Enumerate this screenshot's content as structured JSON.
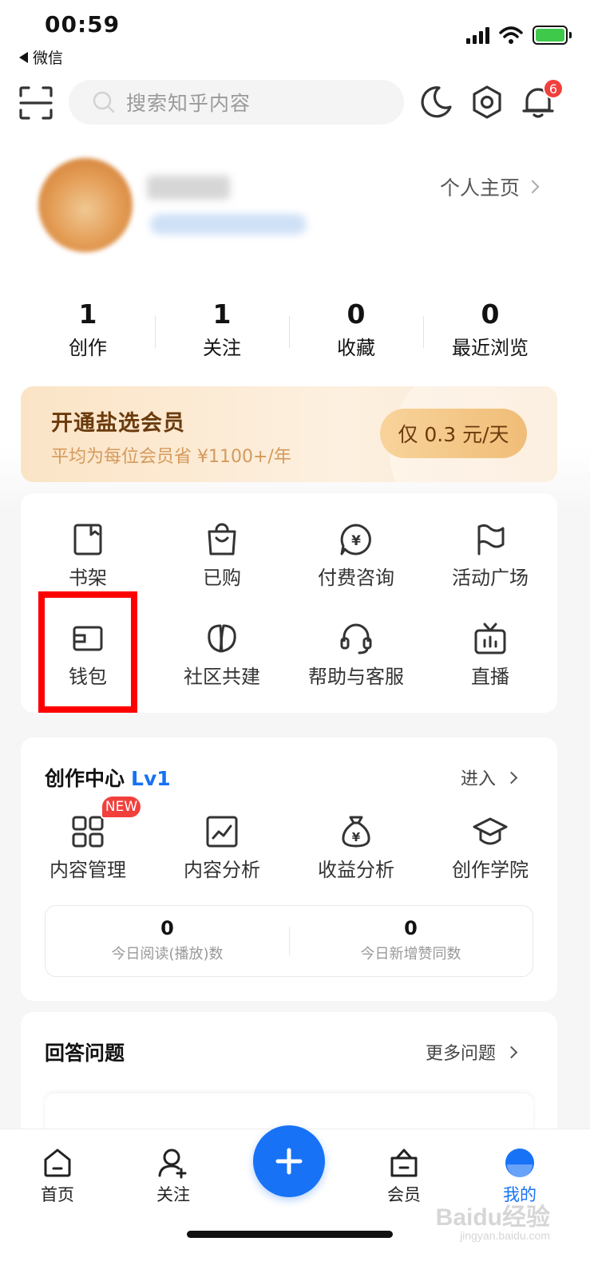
{
  "status_bar": {
    "time": "00:59",
    "back_app": "微信"
  },
  "search": {
    "placeholder": "搜索知乎内容"
  },
  "notifications": {
    "badge": "6"
  },
  "profile": {
    "homepage_link": "个人主页"
  },
  "stats": [
    {
      "value": "1",
      "label": "创作"
    },
    {
      "value": "1",
      "label": "关注"
    },
    {
      "value": "0",
      "label": "收藏"
    },
    {
      "value": "0",
      "label": "最近浏览"
    }
  ],
  "vip": {
    "title": "开通盐选会员",
    "subtitle": "平均为每位会员省 ¥1100+/年",
    "price": "仅 0.3 元/天"
  },
  "services": {
    "row1": [
      {
        "label": "书架",
        "icon": "bookshelf-icon"
      },
      {
        "label": "已购",
        "icon": "shopping-bag-icon"
      },
      {
        "label": "付费咨询",
        "icon": "paid-consult-icon"
      },
      {
        "label": "活动广场",
        "icon": "flag-icon"
      }
    ],
    "row2": [
      {
        "label": "钱包",
        "icon": "wallet-icon"
      },
      {
        "label": "社区共建",
        "icon": "leaf-icon"
      },
      {
        "label": "帮助与客服",
        "icon": "headset-icon"
      },
      {
        "label": "直播",
        "icon": "tv-icon"
      }
    ]
  },
  "creator_center": {
    "title": "创作中心",
    "level": "Lv1",
    "enter": "进入",
    "new_badge": "NEW",
    "items": [
      {
        "label": "内容管理",
        "icon": "grid-icon"
      },
      {
        "label": "内容分析",
        "icon": "chart-icon"
      },
      {
        "label": "收益分析",
        "icon": "money-bag-icon"
      },
      {
        "label": "创作学院",
        "icon": "graduation-cap-icon"
      }
    ],
    "today_reads_value": "0",
    "today_reads_label": "今日阅读(播放)数",
    "today_likes_value": "0",
    "today_likes_label": "今日新增赞同数"
  },
  "answer_questions": {
    "title": "回答问题",
    "more": "更多问题"
  },
  "tabbar": [
    {
      "label": "首页",
      "icon": "home-icon"
    },
    {
      "label": "关注",
      "icon": "follow-icon"
    },
    {
      "label": "会员",
      "icon": "vip-icon"
    },
    {
      "label": "我的",
      "icon": "me-icon"
    }
  ],
  "watermark": {
    "brand": "Baidu经验",
    "url": "jingyan.baidu.com"
  },
  "colors": {
    "accent": "#1772f6",
    "badge_red": "#f1403c",
    "highlight": "#ff0000",
    "vip_text": "#6b3b0d"
  }
}
